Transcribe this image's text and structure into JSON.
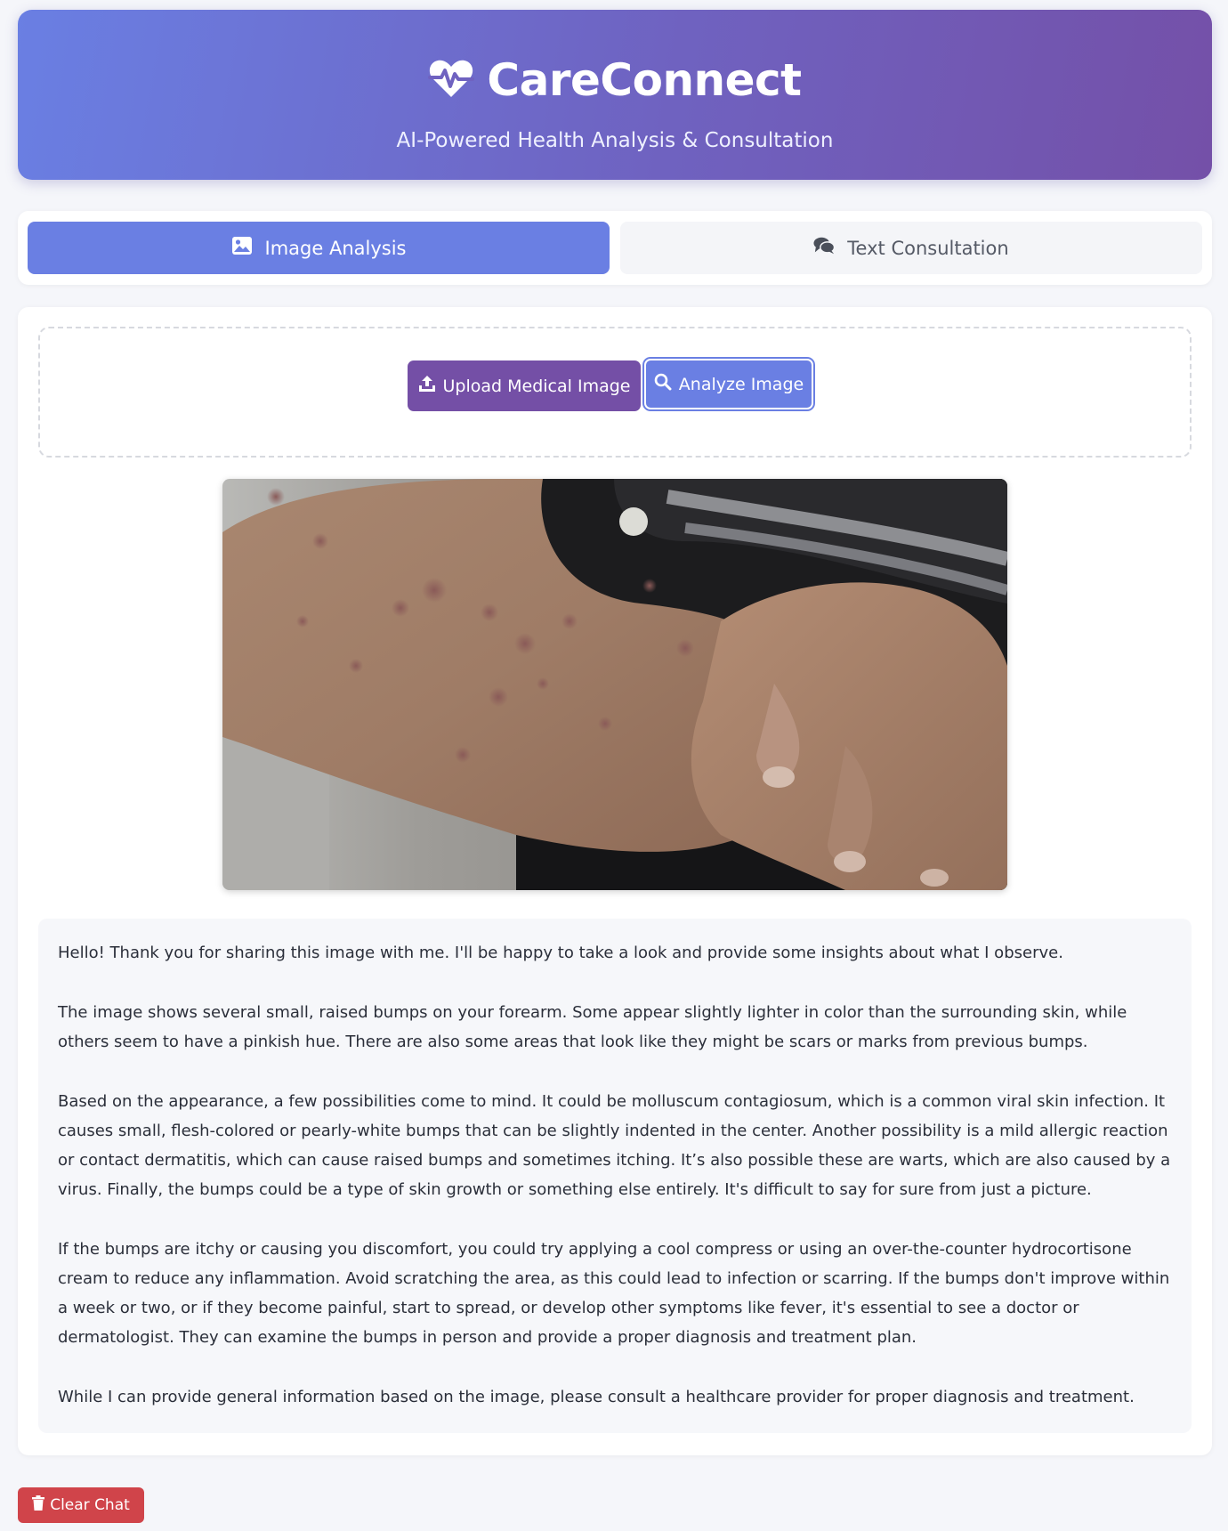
{
  "header": {
    "logo_icon": "heart-pulse-icon",
    "title": "CareConnect",
    "tagline": "AI-Powered Health Analysis & Consultation",
    "gradient_start": "#6a7fe3",
    "gradient_end": "#7450a8"
  },
  "tabs": [
    {
      "label": "Image Analysis",
      "icon": "image-icon",
      "active": true
    },
    {
      "label": "Text Consultation",
      "icon": "comments-icon",
      "active": false
    }
  ],
  "upload": {
    "upload_label": "Upload Medical Image",
    "upload_icon": "upload-icon",
    "analyze_label": "Analyze Image",
    "analyze_icon": "search-icon"
  },
  "image": {
    "subject": "forearm-with-skin-bumps"
  },
  "response": {
    "paragraphs": [
      "Hello! Thank you for sharing this image with me. I'll be happy to take a look and provide some insights about what I observe.",
      "The image shows several small, raised bumps on your forearm. Some appear slightly lighter in color than the surrounding skin, while others seem to have a pinkish hue. There are also some areas that look like they might be scars or marks from previous bumps.",
      "Based on the appearance, a few possibilities come to mind. It could be molluscum contagiosum, which is a common viral skin infection. It causes small, flesh-colored or pearly-white bumps that can be slightly indented in the center. Another possibility is a mild allergic reaction or contact dermatitis, which can cause raised bumps and sometimes itching. It’s also possible these are warts, which are also caused by a virus. Finally, the bumps could be a type of skin growth or something else entirely. It's difficult to say for sure from just a picture.",
      "If the bumps are itchy or causing you discomfort, you could try applying a cool compress or using an over-the-counter hydrocortisone cream to reduce any inflammation. Avoid scratching the area, as this could lead to infection or scarring. If the bumps don't improve within a week or two, or if they become painful, start to spread, or develop other symptoms like fever, it's essential to see a doctor or dermatologist. They can examine the bumps in person and provide a proper diagnosis and treatment plan.",
      "While I can provide general information based on the image, please consult a healthcare provider for proper diagnosis and treatment."
    ]
  },
  "footer": {
    "clear_label": "Clear Chat",
    "clear_icon": "trash-icon",
    "clear_color": "#d0444a"
  }
}
